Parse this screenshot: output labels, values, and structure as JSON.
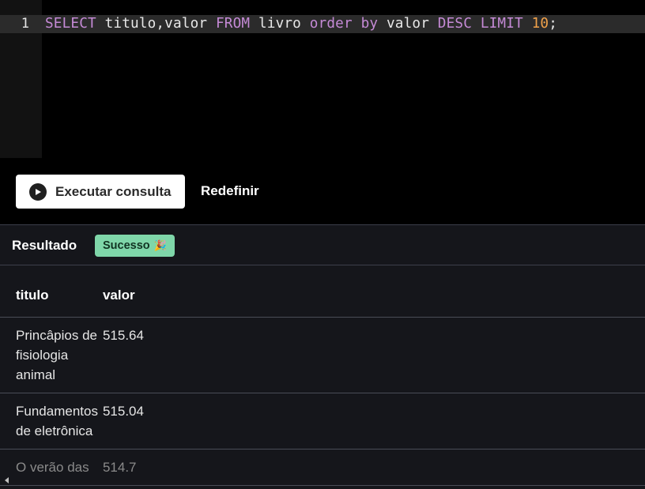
{
  "editor": {
    "line_number": "1",
    "tokens": {
      "select": "SELECT",
      "cols": " titulo,valor ",
      "from": "FROM",
      "table": " livro ",
      "order": "order",
      "sp1": " ",
      "by": "by",
      "valor": " valor ",
      "desc": "DESC",
      "sp2": " ",
      "limit": "LIMIT",
      "sp3": " ",
      "ten": "10",
      "semi": ";"
    }
  },
  "actions": {
    "run_label": "Executar consulta",
    "reset_label": "Redefinir"
  },
  "result": {
    "title": "Resultado",
    "status": "Sucesso",
    "status_icon": "🎉",
    "columns": [
      "titulo",
      "valor"
    ],
    "rows": [
      {
        "titulo": "Princâpios de fisiologia animal",
        "valor": "515.64"
      },
      {
        "titulo": "Fundamentos de eletrônica",
        "valor": "515.04"
      },
      {
        "titulo": "O verão das",
        "valor": "514.7"
      }
    ]
  },
  "colors": {
    "keyword": "#c58ad6",
    "number": "#f0a14a",
    "success_badge": "#7fd6a9"
  }
}
